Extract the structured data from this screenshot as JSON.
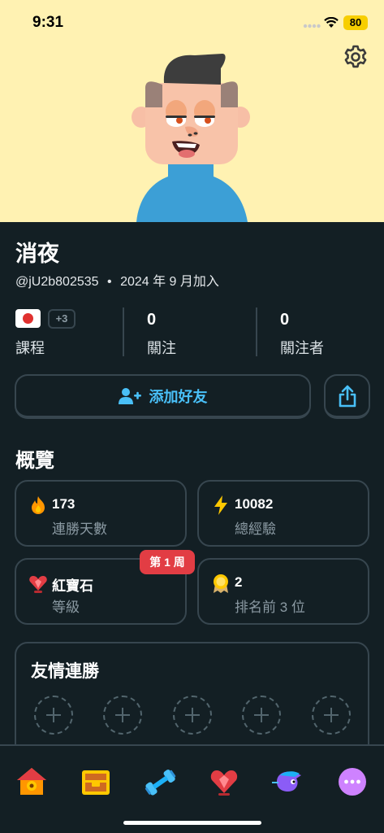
{
  "status": {
    "time": "9:31",
    "battery": "80"
  },
  "profile": {
    "name": "消夜",
    "handle": "@jU2b802535",
    "separator": "•",
    "joined": "2024 年 9 月加入"
  },
  "stats": {
    "courses_extra": "+3",
    "courses_label": "課程",
    "following_value": "0",
    "following_label": "關注",
    "followers_value": "0",
    "followers_label": "關注者"
  },
  "actions": {
    "add_friend": "添加好友"
  },
  "overview": {
    "title": "概覽",
    "cards": [
      {
        "value": "173",
        "label": "連勝天數",
        "icon": "flame-icon"
      },
      {
        "value": "10082",
        "label": "總經驗",
        "icon": "lightning-icon"
      },
      {
        "value": "紅寶石",
        "label": "等級",
        "icon": "ruby-heart-icon",
        "badge": "第 1 周"
      },
      {
        "value": "2",
        "label": "排名前 3 位",
        "icon": "medal-icon"
      }
    ]
  },
  "friends_streak": {
    "title": "友情連勝"
  },
  "tabs": [
    "home-icon",
    "chest-icon",
    "dumbbell-icon",
    "heart-icon",
    "bird-icon",
    "more-icon"
  ],
  "colors": {
    "accent_blue": "#49c0f8",
    "background": "#131f24",
    "hero": "#fff2b2",
    "badge_red": "#e23d44",
    "border": "#37464f"
  }
}
